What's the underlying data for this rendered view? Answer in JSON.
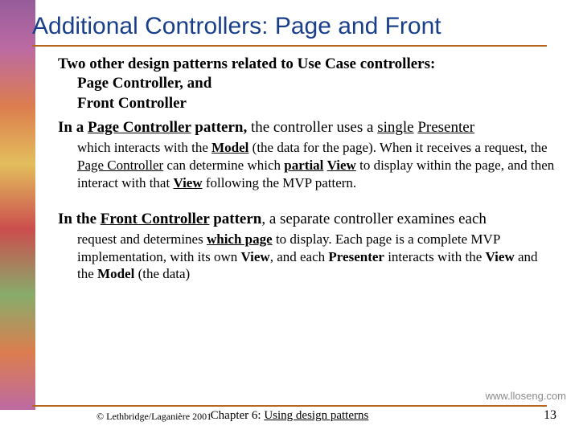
{
  "title": "Additional Controllers:  Page and Front",
  "body": {
    "lead": "Two other design patterns related to Use Case controllers:",
    "item1": "Page Controller, and",
    "item2": "Front Controller",
    "page_controller": {
      "prefix": "In a ",
      "term_u": "Page Controller",
      "term_tail": " pattern,",
      "rest1": " the controller uses a ",
      "single_u": "single",
      "space": " ",
      "presenter_u": "Presenter",
      "sub_a": "which interacts with the ",
      "model_u": "Model",
      "sub_b": " (the data for the page).  When it receives a request, the ",
      "pc_u": "Page Controller",
      "sub_c": " can determine which ",
      "partial_u": "partial",
      "sub_d": " ",
      "view1_u": "View",
      "sub_e": " to display within the page, and then interact with that ",
      "view2_u": "View",
      "sub_f": " following the MVP pattern."
    },
    "front_controller": {
      "prefix": "In the ",
      "term_u": "Front Controller",
      "term_tail": " pattern",
      "rest": ", a separate controller examines each",
      "sub_a": "request and determines ",
      "which_u": "which page",
      "sub_b": " to display.  Each page is a complete MVP implementation, with its own ",
      "view_b": "View",
      "sub_c": ", and each ",
      "presenter_b": "Presenter",
      "sub_d": " interacts with the ",
      "view2_b": "View",
      "sub_e": " and the ",
      "model_b": "Model",
      "sub_f": " (the data)"
    }
  },
  "site": "www.lloseng.com",
  "footer": {
    "left": "© Lethbridge/Laganière 2001",
    "center_pre": "Chapter 6: ",
    "center_u": "Using design patterns",
    "page": "13"
  }
}
